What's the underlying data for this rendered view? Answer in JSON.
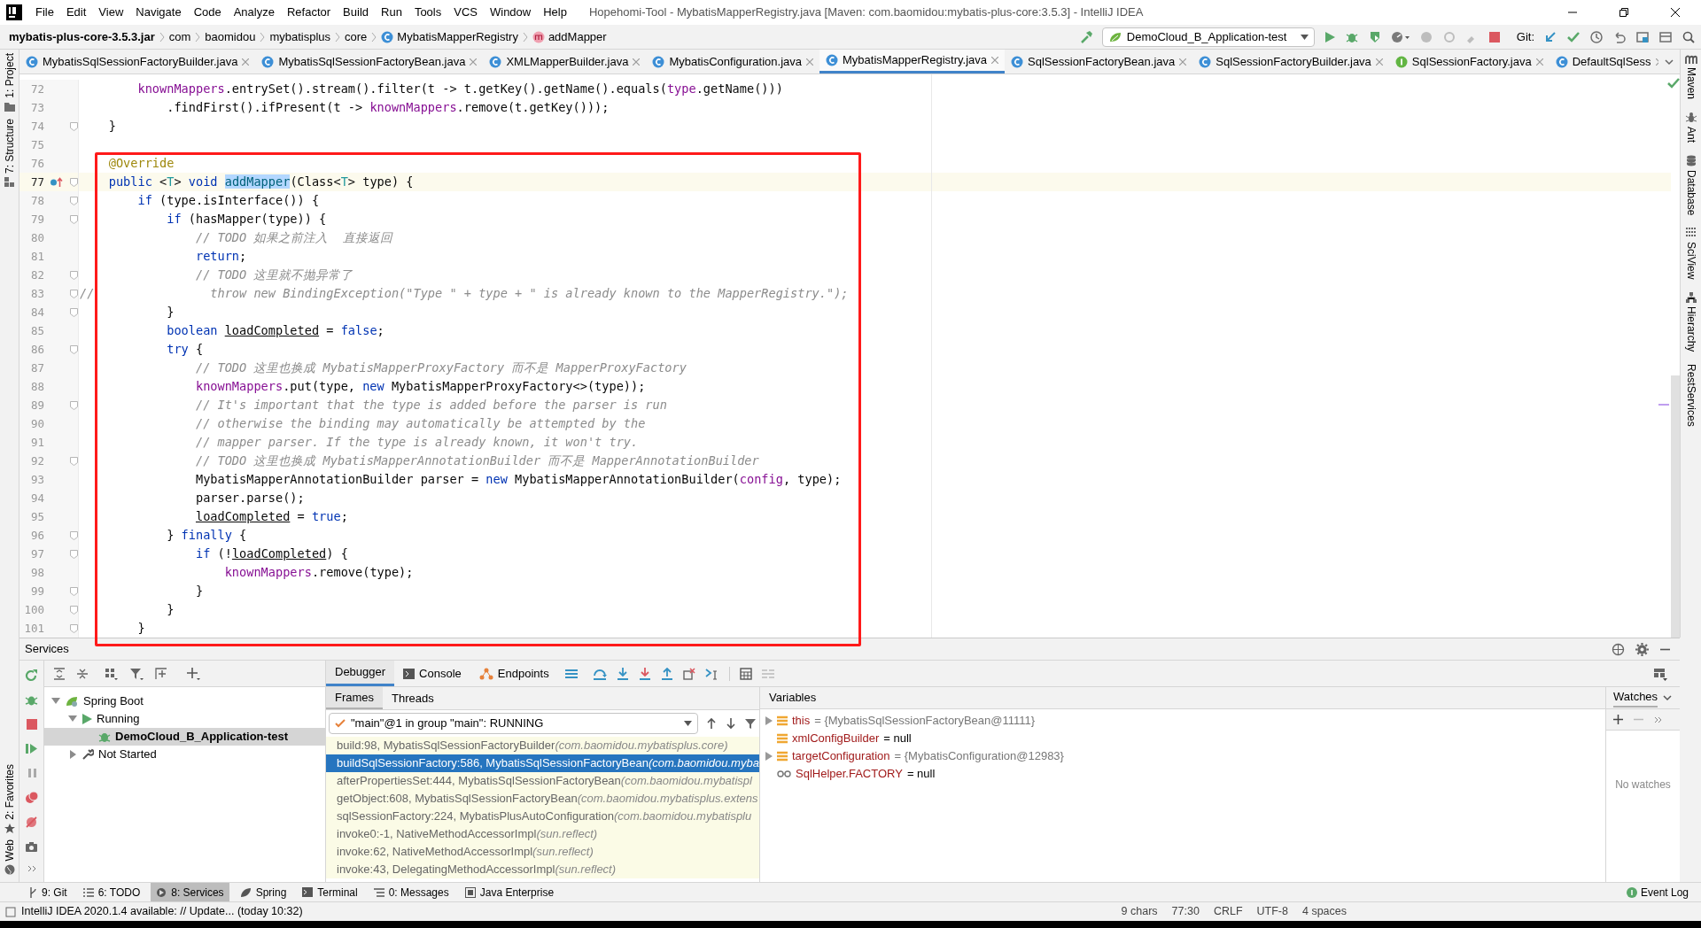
{
  "menu_bar": {
    "items": [
      "File",
      "Edit",
      "View",
      "Navigate",
      "Code",
      "Analyze",
      "Refactor",
      "Build",
      "Run",
      "Tools",
      "VCS",
      "Window",
      "Help"
    ],
    "title": "Hopehomi-Tool - MybatisMapperRegistry.java [Maven: com.baomidou:mybatis-plus-core:3.5.3] - IntelliJ IDEA"
  },
  "breadcrumbs": [
    {
      "label": "mybatis-plus-core-3.5.3.jar",
      "kind": "jar"
    },
    {
      "label": "com",
      "kind": "package"
    },
    {
      "label": "baomidou",
      "kind": "package"
    },
    {
      "label": "mybatisplus",
      "kind": "package"
    },
    {
      "label": "core",
      "kind": "package"
    },
    {
      "label": "MybatisMapperRegistry",
      "kind": "class"
    },
    {
      "label": "addMapper",
      "kind": "method"
    }
  ],
  "run_configuration": "DemoCloud_B_Application-test",
  "vcs_label": "Git:",
  "editor_tabs": [
    {
      "label": "MybatisSqlSessionFactoryBuilder.java",
      "kind": "class",
      "selected": false
    },
    {
      "label": "MybatisSqlSessionFactoryBean.java",
      "kind": "class",
      "selected": false
    },
    {
      "label": "XMLMapperBuilder.java",
      "kind": "class",
      "selected": false
    },
    {
      "label": "MybatisConfiguration.java",
      "kind": "class",
      "selected": false
    },
    {
      "label": "MybatisMapperRegistry.java",
      "kind": "class",
      "selected": true
    },
    {
      "label": "SqlSessionFactoryBean.java",
      "kind": "class",
      "selected": false
    },
    {
      "label": "SqlSessionFactoryBuilder.java",
      "kind": "class",
      "selected": false
    },
    {
      "label": "SqlSessionFactory.java",
      "kind": "interface",
      "selected": false
    },
    {
      "label": "DefaultSqlSess",
      "kind": "class",
      "selected": false
    }
  ],
  "left_tool_windows": [
    {
      "label": "1: Project",
      "kind": "project"
    },
    {
      "label": "7: Structure",
      "kind": "structure"
    }
  ],
  "left_tool_windows_bottom": [
    {
      "label": "2: Favorites",
      "kind": "favorites"
    },
    {
      "label": "Web",
      "kind": "web"
    }
  ],
  "right_tool_windows": [
    {
      "label": "Maven",
      "kind": "maven"
    },
    {
      "label": "Ant",
      "kind": "ant"
    },
    {
      "label": "Database",
      "kind": "database"
    },
    {
      "label": "SciView",
      "kind": "sciview"
    },
    {
      "label": "Hierarchy",
      "kind": "hierarchy"
    },
    {
      "label": "RestServices",
      "kind": "rest"
    }
  ],
  "editor": {
    "lines": [
      {
        "no": "72",
        "fold": false,
        "current": false,
        "marker": false,
        "code": [
          {
            "kind": "field",
            "text": "        knownMappers"
          },
          {
            "kind": "plain",
            "text": ".entrySet().stream().filter(t -> t.getKey().getName().equals("
          },
          {
            "kind": "field",
            "text": "type"
          },
          {
            "kind": "plain",
            "text": ".getName()))"
          }
        ]
      },
      {
        "no": "73",
        "fold": false,
        "current": false,
        "marker": false,
        "code": [
          {
            "kind": "plain",
            "text": "            .findFirst().ifPresent(t -> "
          },
          {
            "kind": "field",
            "text": "knownMappers"
          },
          {
            "kind": "plain",
            "text": ".remove(t.getKey()));"
          }
        ]
      },
      {
        "no": "74",
        "fold": true,
        "current": false,
        "marker": false,
        "code": [
          {
            "kind": "plain",
            "text": "    }"
          }
        ]
      },
      {
        "no": "75",
        "fold": false,
        "current": false,
        "marker": false
      },
      {
        "no": "76",
        "fold": false,
        "current": false,
        "marker": false,
        "code": [
          {
            "kind": "annotation",
            "text": "    @Override"
          }
        ]
      },
      {
        "no": "77",
        "fold": true,
        "current": true,
        "marker": true,
        "code": [
          {
            "kind": "keyword",
            "text": "    public"
          },
          {
            "kind": "plain",
            "text": " <"
          },
          {
            "kind": "typeparam",
            "text": "T"
          },
          {
            "kind": "plain",
            "text": "> "
          },
          {
            "kind": "keyword",
            "text": "void "
          },
          {
            "kind": "selected",
            "text": "addMapper"
          },
          {
            "kind": "plain",
            "text": "(Class<"
          },
          {
            "kind": "typeparam",
            "text": "T"
          },
          {
            "kind": "plain",
            "text": "> type) {"
          }
        ]
      },
      {
        "no": "78",
        "fold": true,
        "current": false,
        "marker": false,
        "code": [
          {
            "kind": "keyword",
            "text": "        if"
          },
          {
            "kind": "plain",
            "text": " (type.isInterface()) {"
          }
        ]
      },
      {
        "no": "79",
        "fold": true,
        "current": false,
        "marker": false,
        "code": [
          {
            "kind": "keyword",
            "text": "            if"
          },
          {
            "kind": "plain",
            "text": " (hasMapper(type)) {"
          }
        ]
      },
      {
        "no": "80",
        "fold": false,
        "current": false,
        "marker": false,
        "code": [
          {
            "kind": "comment",
            "text": "                // TODO 如果之前注入  直接返回"
          }
        ]
      },
      {
        "no": "81",
        "fold": false,
        "current": false,
        "marker": false,
        "code": [
          {
            "kind": "keyword",
            "text": "                return"
          },
          {
            "kind": "plain",
            "text": ";"
          }
        ]
      },
      {
        "no": "82",
        "fold": true,
        "current": false,
        "marker": false,
        "code": [
          {
            "kind": "comment",
            "text": "                // TODO 这里就不抛异常了"
          }
        ]
      },
      {
        "no": "83",
        "fold": true,
        "current": false,
        "marker": false,
        "code": [
          {
            "kind": "comment",
            "text": "//                throw new BindingException(\"Type \" + type + \" is already known to the MapperRegistry.\");"
          }
        ]
      },
      {
        "no": "84",
        "fold": true,
        "current": false,
        "marker": false,
        "code": [
          {
            "kind": "plain",
            "text": "            }"
          }
        ]
      },
      {
        "no": "85",
        "fold": false,
        "current": false,
        "marker": false,
        "code": [
          {
            "kind": "keyword",
            "text": "            boolean "
          },
          {
            "kind": "underlined",
            "text": "loadCompleted"
          },
          {
            "kind": "plain",
            "text": " = "
          },
          {
            "kind": "keyword",
            "text": "false"
          },
          {
            "kind": "plain",
            "text": ";"
          }
        ]
      },
      {
        "no": "86",
        "fold": true,
        "current": false,
        "marker": false,
        "code": [
          {
            "kind": "keyword",
            "text": "            try"
          },
          {
            "kind": "plain",
            "text": " {"
          }
        ]
      },
      {
        "no": "87",
        "fold": false,
        "current": false,
        "marker": false,
        "code": [
          {
            "kind": "comment",
            "text": "                // TODO 这里也换成 MybatisMapperProxyFactory 而不是 MapperProxyFactory"
          }
        ]
      },
      {
        "no": "88",
        "fold": false,
        "current": false,
        "marker": false,
        "code": [
          {
            "kind": "field",
            "text": "                knownMappers"
          },
          {
            "kind": "plain",
            "text": ".put(type, "
          },
          {
            "kind": "keyword",
            "text": "new"
          },
          {
            "kind": "plain",
            "text": " MybatisMapperProxyFactory<>(type));"
          }
        ]
      },
      {
        "no": "89",
        "fold": true,
        "current": false,
        "marker": false,
        "code": [
          {
            "kind": "comment",
            "text": "                // It's important that the type is added before the parser is run"
          }
        ]
      },
      {
        "no": "90",
        "fold": false,
        "current": false,
        "marker": false,
        "code": [
          {
            "kind": "comment",
            "text": "                // otherwise the binding may automatically be attempted by the"
          }
        ]
      },
      {
        "no": "91",
        "fold": false,
        "current": false,
        "marker": false,
        "code": [
          {
            "kind": "comment",
            "text": "                // mapper parser. If the type is already known, it won't try."
          }
        ]
      },
      {
        "no": "92",
        "fold": true,
        "current": false,
        "marker": false,
        "code": [
          {
            "kind": "comment",
            "text": "                // TODO 这里也换成 MybatisMapperAnnotationBuilder 而不是 MapperAnnotationBuilder"
          }
        ]
      },
      {
        "no": "93",
        "fold": false,
        "current": false,
        "marker": false,
        "code": [
          {
            "kind": "plain",
            "text": "                MybatisMapperAnnotationBuilder parser = "
          },
          {
            "kind": "keyword",
            "text": "new"
          },
          {
            "kind": "plain",
            "text": " MybatisMapperAnnotationBuilder("
          },
          {
            "kind": "field",
            "text": "config"
          },
          {
            "kind": "plain",
            "text": ", type);"
          }
        ]
      },
      {
        "no": "94",
        "fold": false,
        "current": false,
        "marker": false,
        "code": [
          {
            "kind": "plain",
            "text": "                parser.parse();"
          }
        ]
      },
      {
        "no": "95",
        "fold": false,
        "current": false,
        "marker": false,
        "code": [
          {
            "kind": "underlined",
            "text": "                loadCompleted"
          },
          {
            "kind": "plain",
            "text": " = "
          },
          {
            "kind": "keyword",
            "text": "true"
          },
          {
            "kind": "plain",
            "text": ";"
          }
        ]
      },
      {
        "no": "96",
        "fold": true,
        "current": false,
        "marker": false,
        "code": [
          {
            "kind": "plain",
            "text": "            } "
          },
          {
            "kind": "keyword",
            "text": "finally"
          },
          {
            "kind": "plain",
            "text": " {"
          }
        ]
      },
      {
        "no": "97",
        "fold": true,
        "current": false,
        "marker": false,
        "code": [
          {
            "kind": "keyword",
            "text": "                if"
          },
          {
            "kind": "plain",
            "text": " (!"
          },
          {
            "kind": "underlined",
            "text": "loadCompleted"
          },
          {
            "kind": "plain",
            "text": ") {"
          }
        ]
      },
      {
        "no": "98",
        "fold": false,
        "current": false,
        "marker": false,
        "code": [
          {
            "kind": "field",
            "text": "                    knownMappers"
          },
          {
            "kind": "plain",
            "text": ".remove(type);"
          }
        ]
      },
      {
        "no": "99",
        "fold": true,
        "current": false,
        "marker": false,
        "code": [
          {
            "kind": "plain",
            "text": "                }"
          }
        ]
      },
      {
        "no": "100",
        "fold": true,
        "current": false,
        "marker": false,
        "code": [
          {
            "kind": "plain",
            "text": "            }"
          }
        ]
      },
      {
        "no": "101",
        "fold": true,
        "current": false,
        "marker": false,
        "code": [
          {
            "kind": "plain",
            "text": "        }"
          }
        ]
      }
    ]
  },
  "services": {
    "title": "Services",
    "tree": [
      {
        "label": "Spring Boot",
        "kind": "group",
        "expanded": true,
        "selected": false,
        "children": [
          {
            "label": "Running",
            "kind": "running",
            "expanded": true,
            "selected": false,
            "children": [
              {
                "label": "DemoCloud_B_Application-test",
                "kind": "app",
                "selected": true
              }
            ]
          },
          {
            "label": "Not Started",
            "kind": "stopped",
            "expanded": false,
            "selected": false
          }
        ]
      }
    ],
    "debugger_tabs": [
      {
        "label": "Debugger",
        "kind": "debugger",
        "selected": true
      },
      {
        "label": "Console",
        "kind": "console",
        "selected": false
      },
      {
        "label": "Endpoints",
        "kind": "endpoints",
        "selected": false
      }
    ],
    "frame_tabs": [
      {
        "label": "Frames",
        "selected": true
      },
      {
        "label": "Threads",
        "selected": false
      }
    ],
    "thread": "\"main\"@1 in group \"main\": RUNNING",
    "frames": [
      {
        "method": "build:98, MybatisSqlSessionFactoryBuilder",
        "package": "(com.baomidou.mybatisplus.core)",
        "selected": false
      },
      {
        "method": "buildSqlSessionFactory:586, MybatisSqlSessionFactoryBean",
        "package": "(com.baomidou.myba",
        "selected": true
      },
      {
        "method": "afterPropertiesSet:444, MybatisSqlSessionFactoryBean",
        "package": "(com.baomidou.mybatispl",
        "selected": false
      },
      {
        "method": "getObject:608, MybatisSqlSessionFactoryBean",
        "package": "(com.baomidou.mybatisplus.extens",
        "selected": false
      },
      {
        "method": "sqlSessionFactory:224, MybatisPlusAutoConfiguration",
        "package": "(com.baomidou.mybatisplu",
        "selected": false
      },
      {
        "method": "invoke0:-1, NativeMethodAccessorImpl",
        "package": "(sun.reflect)",
        "selected": false
      },
      {
        "method": "invoke:62, NativeMethodAccessorImpl",
        "package": "(sun.reflect)",
        "selected": false
      },
      {
        "method": "invoke:43, DelegatingMethodAccessorImpl",
        "package": "(sun.reflect)",
        "selected": false
      }
    ],
    "variables_title": "Variables",
    "variables": [
      {
        "kind": "field",
        "expandable": true,
        "name": "this",
        "value": "= {MybatisSqlSessionFactoryBean@11111}",
        "object": true
      },
      {
        "kind": "field",
        "expandable": false,
        "name": "xmlConfigBuilder",
        "value": "= null",
        "object": false
      },
      {
        "kind": "field",
        "expandable": true,
        "name": "targetConfiguration",
        "value": "= {MybatisConfiguration@12983}",
        "object": true
      },
      {
        "kind": "watch",
        "expandable": false,
        "name": "SqlHelper.FACTORY",
        "value": "= null",
        "object": false
      }
    ],
    "watches_title": "Watches",
    "watches_empty": "No watches"
  },
  "tool_window_bar": [
    {
      "label": "9: Git",
      "kind": "git",
      "selected": false
    },
    {
      "label": "6: TODO",
      "kind": "todo",
      "selected": false
    },
    {
      "label": "8: Services",
      "kind": "services",
      "selected": true
    },
    {
      "label": "Spring",
      "kind": "spring",
      "selected": false
    },
    {
      "label": "Terminal",
      "kind": "terminal",
      "selected": false
    },
    {
      "label": "0: Messages",
      "kind": "messages",
      "selected": false
    },
    {
      "label": "Java Enterprise",
      "kind": "enterprise",
      "selected": false
    }
  ],
  "event_log": "Event Log",
  "status_bar": {
    "message": "IntelliJ IDEA 2020.1.4 available: // Update... (today 10:32)",
    "items": [
      "9 chars",
      "77:30",
      "CRLF",
      "UTF-8",
      "4 spaces"
    ]
  }
}
